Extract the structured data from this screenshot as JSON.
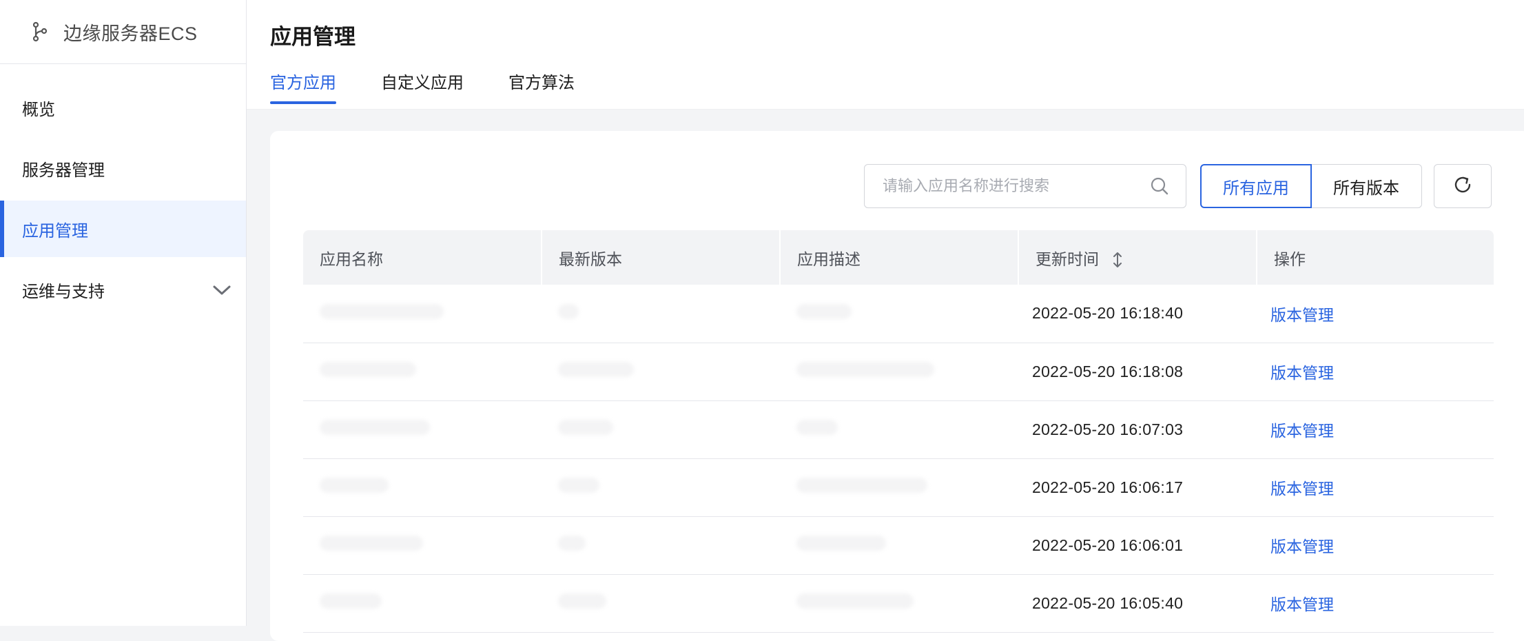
{
  "sidebar": {
    "brand_title": "边缘服务器ECS",
    "items": [
      {
        "label": "概览"
      },
      {
        "label": "服务器管理"
      },
      {
        "label": "应用管理"
      },
      {
        "label": "运维与支持"
      }
    ]
  },
  "header": {
    "title": "应用管理",
    "tabs": [
      {
        "label": "官方应用"
      },
      {
        "label": "自定义应用"
      },
      {
        "label": "官方算法"
      }
    ]
  },
  "toolbar": {
    "search_placeholder": "请输入应用名称进行搜索",
    "filter_all_apps": "所有应用",
    "filter_all_versions": "所有版本"
  },
  "table": {
    "columns": [
      {
        "label": "应用名称"
      },
      {
        "label": "最新版本"
      },
      {
        "label": "应用描述"
      },
      {
        "label": "更新时间"
      },
      {
        "label": "操作"
      }
    ],
    "rows": [
      {
        "updated": "2022-05-20 16:18:40",
        "action": "版本管理"
      },
      {
        "updated": "2022-05-20 16:18:08",
        "action": "版本管理"
      },
      {
        "updated": "2022-05-20 16:07:03",
        "action": "版本管理"
      },
      {
        "updated": "2022-05-20 16:06:17",
        "action": "版本管理"
      },
      {
        "updated": "2022-05-20 16:06:01",
        "action": "版本管理"
      },
      {
        "updated": "2022-05-20 16:05:40",
        "action": "版本管理"
      }
    ]
  },
  "colors": {
    "accent": "#2a64e0",
    "active_nav_bg": "#eef4ff",
    "table_header_bg": "#f2f3f5",
    "page_bg": "#f3f4f6"
  },
  "icons": {
    "brand": "branch-icon",
    "search": "search-icon",
    "refresh": "refresh-icon",
    "sort": "sort-icon",
    "expand": "chevron-down-icon"
  }
}
